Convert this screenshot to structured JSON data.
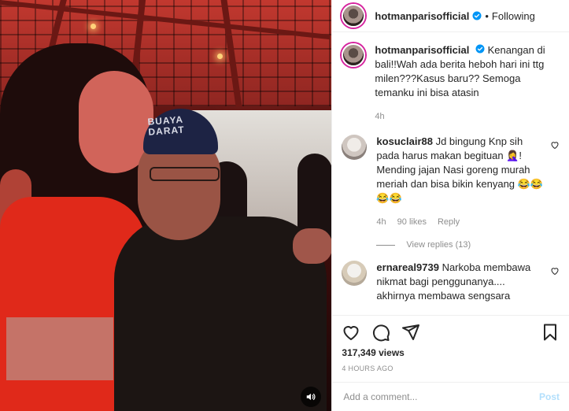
{
  "post": {
    "username": "hotmanparisofficial",
    "follow_separator": "•",
    "follow_status": "Following",
    "verified_icon": "verified-badge-icon",
    "video_sound_icon": "speaker-icon",
    "video_cap_text": "BUAYA DARAT"
  },
  "caption": {
    "username": "hotmanparisofficial",
    "text": "Kenangan di bali!!Wah ada berita heboh hari ini ttg milen???Kasus baru?? Semoga temanku ini bisa atasin",
    "time": "4h"
  },
  "comments": [
    {
      "username": "kosuclair88",
      "text": "Jd bingung Knp sih pada harus makan begituan 🤦‍♀️! Mending jajan Nasi goreng murah meriah dan bisa bikin kenyang 😂😂😂😂",
      "time": "4h",
      "likes": "90 likes",
      "reply": "Reply",
      "view_replies": "View replies (13)"
    },
    {
      "username": "ernareal9739",
      "text": "Narkoba membawa nikmat bagi penggunanya.... akhirnya membawa sengsara"
    }
  ],
  "stats": {
    "views": "317,349 views",
    "posted": "4 HOURS AGO"
  },
  "comment_box": {
    "placeholder": "Add a comment...",
    "post_label": "Post"
  },
  "colors": {
    "verified": "#0095f6",
    "post_button": "#b2dffc",
    "story_ring": "#d6249f"
  }
}
